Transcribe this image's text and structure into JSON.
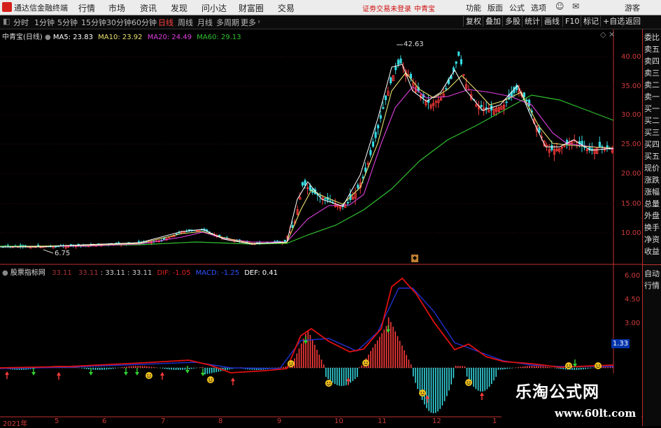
{
  "menubar": {
    "app_title": "通达信金融终端",
    "items": [
      "行情",
      "市场",
      "资讯",
      "发现",
      "问小达",
      "财富圈",
      "交易"
    ],
    "warning": "证劵交易未登录",
    "symbol": "中青宝",
    "right_items": [
      "功能",
      "版面",
      "公式",
      "选项",
      "游客"
    ]
  },
  "toolbar": {
    "periods": [
      "分时",
      "1分钟",
      "5分钟",
      "15分钟",
      "30分钟",
      "60分钟",
      "日线",
      "周线",
      "月线",
      "多周期",
      "更多"
    ],
    "active_period": "日线",
    "right_buttons": [
      "复权",
      "叠加",
      "多股",
      "统计",
      "画线",
      "F10",
      "标记",
      "+自选",
      "返回"
    ]
  },
  "price_legend": {
    "title": "中青宝(日线)",
    "ma5": "MA5: 23.83",
    "ma10": "MA10: 23.92",
    "ma20": "MA20: 24.49",
    "ma60": "MA60: 29.13"
  },
  "macd_legend": {
    "title": "股票指标网",
    "v1": "33.11",
    "v2": "33.11",
    "v3": ": 33.11",
    "v4": ": 33.11",
    "dif": "DIF: -1.05",
    "macd": "MACD: -1.25",
    "def": "DEF: 0.41"
  },
  "price_axis": [
    "40.00",
    "35.00",
    "30.00",
    "25.00",
    "20.00",
    "15.00",
    "10.00"
  ],
  "macd_axis": [
    "6.00",
    "4.50",
    "3.00"
  ],
  "macd_current": "1.33",
  "annotations": {
    "high": "42.63",
    "low": "6.75"
  },
  "x_axis": [
    "2021年",
    "5",
    "6",
    "7",
    "8",
    "9",
    "10",
    "11",
    "12",
    "1"
  ],
  "right_panel": [
    "委比",
    "卖五",
    "卖四",
    "卖三",
    "卖二",
    "卖一",
    "买一",
    "买二",
    "买三",
    "买四",
    "买五",
    "现价",
    "涨跌",
    "涨幅",
    "总量",
    "外盘",
    "换手",
    "净资",
    "收益"
  ],
  "right_panel_bottom": [
    "自动",
    "行情"
  ],
  "watermark": {
    "title": "乐淘公式网",
    "url": "www.60lt.com"
  },
  "colors": {
    "up": "#ff3b3b",
    "down": "#35d8e0",
    "ma5": "#ffffff",
    "ma10": "#e8e070",
    "ma20": "#e040e0",
    "ma60": "#30c030"
  },
  "chart_data": [
    {
      "type": "line",
      "title": "中青宝(日线)",
      "series": [
        {
          "name": "MA60",
          "values": [
            7.6,
            7.7,
            7.8,
            8.0,
            8.3,
            8.5,
            8.8,
            9.0,
            10.0,
            12.5,
            16.0,
            20.5,
            25.0,
            29.5,
            32.5,
            33.5,
            31.5,
            29.1
          ]
        }
      ],
      "x": [
        "2021年",
        "5",
        "6",
        "7",
        "8",
        "9",
        "10",
        "11",
        "12",
        "1"
      ],
      "ylim": [
        6,
        43
      ]
    }
  ]
}
